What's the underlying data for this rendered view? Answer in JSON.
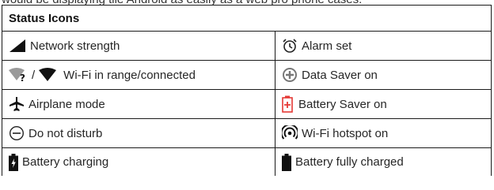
{
  "partial_text": "would be displaying tile Android as easily as a web pro phone cases.",
  "table": {
    "header": "Status Icons",
    "rows": [
      {
        "left": {
          "icon": "network-strength-icon",
          "label": "Network strength"
        },
        "right": {
          "icon": "alarm-clock-icon",
          "label": "Alarm set"
        }
      },
      {
        "left": {
          "icon": "wifi-in-range-connected-icon",
          "label": "Wi-Fi in range/connected"
        },
        "right": {
          "icon": "data-saver-icon",
          "label": "Data Saver on"
        }
      },
      {
        "left": {
          "icon": "airplane-icon",
          "label": "Airplane mode"
        },
        "right": {
          "icon": "battery-saver-icon",
          "label": "Battery Saver on"
        }
      },
      {
        "left": {
          "icon": "do-not-disturb-icon",
          "label": "Do not disturb"
        },
        "right": {
          "icon": "wifi-hotspot-icon",
          "label": "Wi-Fi hotspot on"
        }
      },
      {
        "left": {
          "icon": "battery-charging-icon",
          "label": "Battery charging"
        },
        "right": {
          "icon": "battery-full-icon",
          "label": "Battery fully charged"
        }
      }
    ]
  },
  "colors": {
    "border": "#1a1a1a",
    "text": "#262626",
    "battery_saver_red": "#e53935"
  }
}
